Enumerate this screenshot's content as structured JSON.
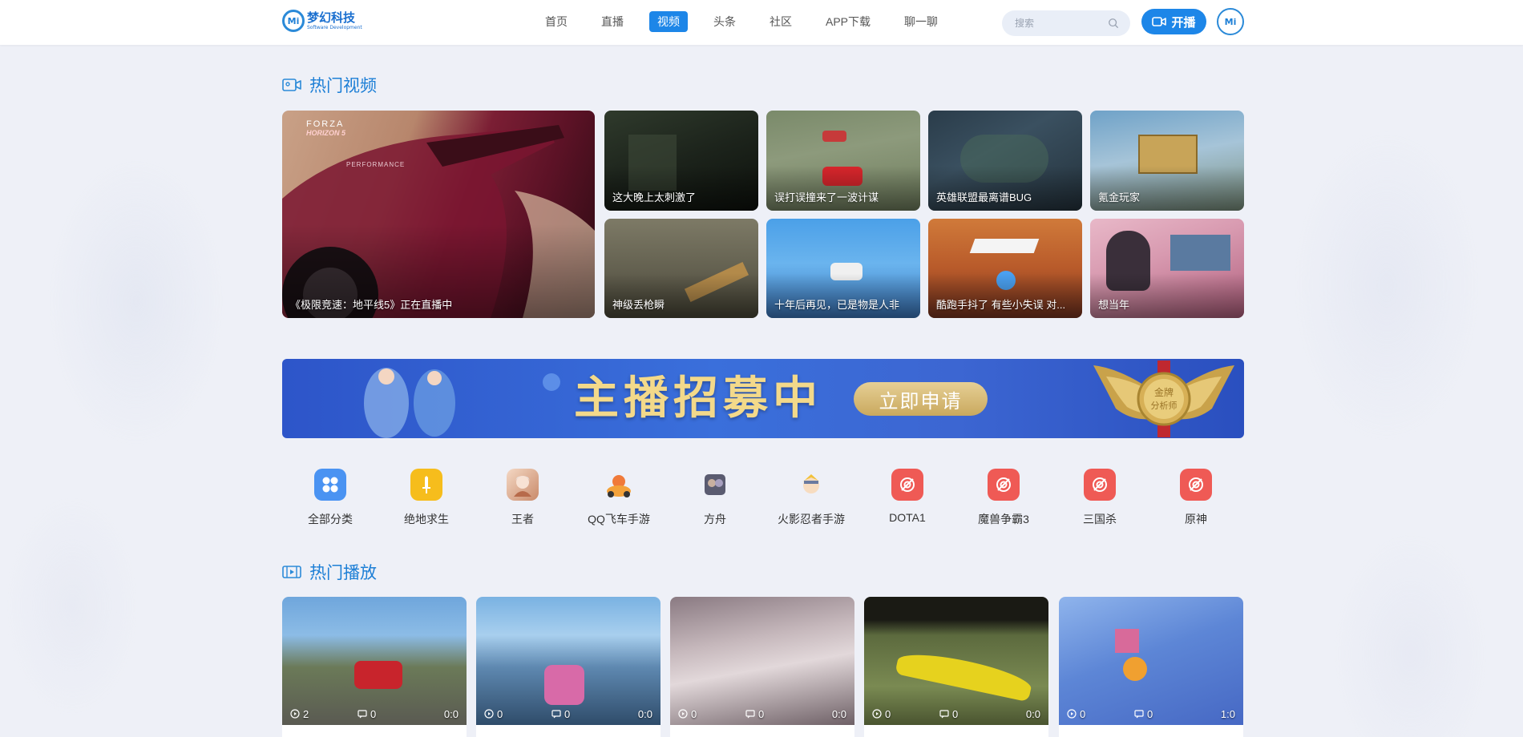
{
  "brand": {
    "mark": "Mi",
    "name_cn": "梦幻科技",
    "name_en": "Software Development"
  },
  "nav": {
    "items": [
      "首页",
      "直播",
      "视频",
      "头条",
      "社区",
      "APP下载",
      "聊一聊"
    ],
    "active_index": 2
  },
  "search": {
    "placeholder": "搜索"
  },
  "live_button": {
    "label": "开播"
  },
  "avatar": {
    "mark": "Mi"
  },
  "hot_videos": {
    "title": "热门视频",
    "feature": {
      "caption": "《极限竞速：地平线5》正在直播中",
      "overlay_logo_1": "FORZA",
      "overlay_logo_2": "HORIZON 5",
      "overlay_text": "PERFORMANCE"
    },
    "tiles": [
      {
        "caption": "这大晚上太刺激了"
      },
      {
        "caption": "误打误撞来了一波计谋"
      },
      {
        "caption": "英雄联盟最离谱BUG"
      },
      {
        "caption": "氪金玩家"
      },
      {
        "caption": "神级丢枪瞬"
      },
      {
        "caption": "十年后再见，已是物是人非"
      },
      {
        "caption": "酷跑手抖了 有些小失误 对..."
      },
      {
        "caption": "想当年"
      }
    ]
  },
  "banner": {
    "title": "主播招募中",
    "button": "立即申请",
    "badge_line1": "金牌",
    "badge_line2": "分析师"
  },
  "categories": [
    {
      "label": "全部分类",
      "icon": "grid-icon",
      "color": "#3d8ef5"
    },
    {
      "label": "绝地求生",
      "icon": "dagger-icon",
      "color": "#f5b820"
    },
    {
      "label": "王者",
      "icon": "hero-portrait-icon",
      "color": "#c98a6a"
    },
    {
      "label": "QQ飞车手游",
      "icon": "kart-icon",
      "color": "#f07a3a"
    },
    {
      "label": "方舟",
      "icon": "ark-icon",
      "color": "#6e6f86"
    },
    {
      "label": "火影忍者手游",
      "icon": "ninja-icon",
      "color": "#e8c27a"
    },
    {
      "label": "DOTA1",
      "icon": "target-icon",
      "color": "#ef5350"
    },
    {
      "label": "魔兽争霸3",
      "icon": "target-icon",
      "color": "#ef5350"
    },
    {
      "label": "三国杀",
      "icon": "target-icon",
      "color": "#ef5350"
    },
    {
      "label": "原神",
      "icon": "target-icon",
      "color": "#ef5350"
    }
  ],
  "hot_play": {
    "title": "热门播放",
    "cards": [
      {
        "plays": "2",
        "comments": "0",
        "duration": "0:0"
      },
      {
        "plays": "0",
        "comments": "0",
        "duration": "0:0"
      },
      {
        "plays": "0",
        "comments": "0",
        "duration": "0:0"
      },
      {
        "plays": "0",
        "comments": "0",
        "duration": "0:0"
      },
      {
        "plays": "0",
        "comments": "0",
        "duration": "1:0"
      }
    ]
  },
  "colors": {
    "accent": "#1d86e8",
    "title": "#1d7fd6",
    "background": "#eef0f7"
  }
}
